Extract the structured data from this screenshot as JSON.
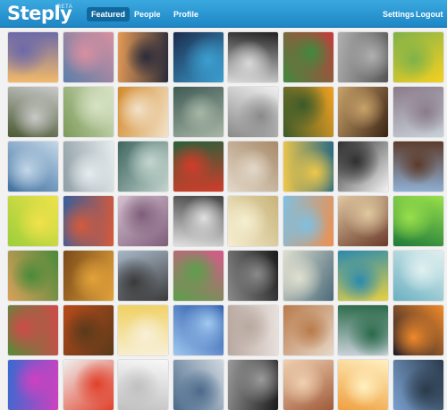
{
  "app": {
    "logo": "Steply",
    "badge": "BETA"
  },
  "nav": {
    "featured": "Featured",
    "people": "People",
    "profile": "Profile",
    "settings": "Settings",
    "logout": "Logout"
  },
  "colors": {
    "topbar": "#2a9ad6",
    "active_nav": "#11689f",
    "background": "#f2f2f2"
  },
  "photos": [
    [
      "#f2b96a",
      "#6d6aa8"
    ],
    [
      "#5c7fa8",
      "#d98fa0"
    ],
    [
      "#e49a56",
      "#2b2b3a"
    ],
    [
      "#1b2b4d",
      "#3b9fd0"
    ],
    [
      "#222222",
      "#d9d9d9"
    ],
    [
      "#c73b3b",
      "#3f8a3f"
    ],
    [
      "#555555",
      "#b0b0b0"
    ],
    [
      "#f5d020",
      "#7fb24a"
    ],
    [
      "#4a5a33",
      "#c9c9c9"
    ],
    [
      "#7c9a5a",
      "#d7e3c4"
    ],
    [
      "#d48a2c",
      "#f2e2c9"
    ],
    [
      "#3f5a55",
      "#a7b7a6"
    ],
    [
      "#efefef",
      "#8a8a8a"
    ],
    [
      "#f0a020",
      "#3a5a2a"
    ],
    [
      "#3b2414",
      "#c8a26a"
    ],
    [
      "#c7d0d8",
      "#8b7b8a"
    ],
    [
      "#3d6fa0",
      "#c3d7e8"
    ],
    [
      "#8f9ea5",
      "#e6ecef"
    ],
    [
      "#3f6660",
      "#c4d5cf"
    ],
    [
      "#2d5f3a",
      "#d23c2a"
    ],
    [
      "#a88a6a",
      "#e2d8c8"
    ],
    [
      "#2a6b82",
      "#f0c84a"
    ],
    [
      "#f4f4f4",
      "#2f2f2f"
    ],
    [
      "#8fb0d4",
      "#5c3b2a"
    ],
    [
      "#9ccf3a",
      "#f0e24a"
    ],
    [
      "#3a5f9a",
      "#d65a3a"
    ],
    [
      "#d5c0d0",
      "#7e5e7a"
    ],
    [
      "#444444",
      "#e0e0e0"
    ],
    [
      "#c9b37a",
      "#f5eed0"
    ],
    [
      "#ef8f4f",
      "#7fc0e0"
    ],
    [
      "#6a3a2a",
      "#e0c8a0"
    ],
    [
      "#1e7a3a",
      "#98e04a"
    ],
    [
      "#d9a05a",
      "#4a8a3a"
    ],
    [
      "#7a4a1a",
      "#e2a23a"
    ],
    [
      "#a8b8c8",
      "#3a3a3a"
    ],
    [
      "#d65a8a",
      "#5aa04a"
    ],
    [
      "#1a1a1a",
      "#8a8a8a"
    ],
    [
      "#4a6a7a",
      "#e0e0d0"
    ],
    [
      "#e8d040",
      "#2a8ab0"
    ],
    [
      "#6ab0c0",
      "#e0f0f0"
    ],
    [
      "#5a8a3a",
      "#d04a4a"
    ],
    [
      "#b84a1a",
      "#5a3a1a"
    ],
    [
      "#f0d060",
      "#f8f0d8"
    ],
    [
      "#1a4aa0",
      "#a0c8f0"
    ],
    [
      "#e8e0dc",
      "#b8a8a0"
    ],
    [
      "#e8d8c8",
      "#b87a4a"
    ],
    [
      "#c8d0d8",
      "#2a6a4a"
    ],
    [
      "#1a1a2a",
      "#f08a2a"
    ],
    [
      "#3a6ad0",
      "#d040c0"
    ],
    [
      "#f0f0f0",
      "#e0402a"
    ],
    [
      "#f8f8f8",
      "#c0c0c0"
    ],
    [
      "#d0d8e0",
      "#4a6a8a"
    ],
    [
      "#1a1a1a",
      "#9a9a9a"
    ],
    [
      "#a05a3a",
      "#f0d0b0"
    ],
    [
      "#f0a040",
      "#fff0c0"
    ],
    [
      "#7aa0d0",
      "#2a3a4a"
    ]
  ]
}
